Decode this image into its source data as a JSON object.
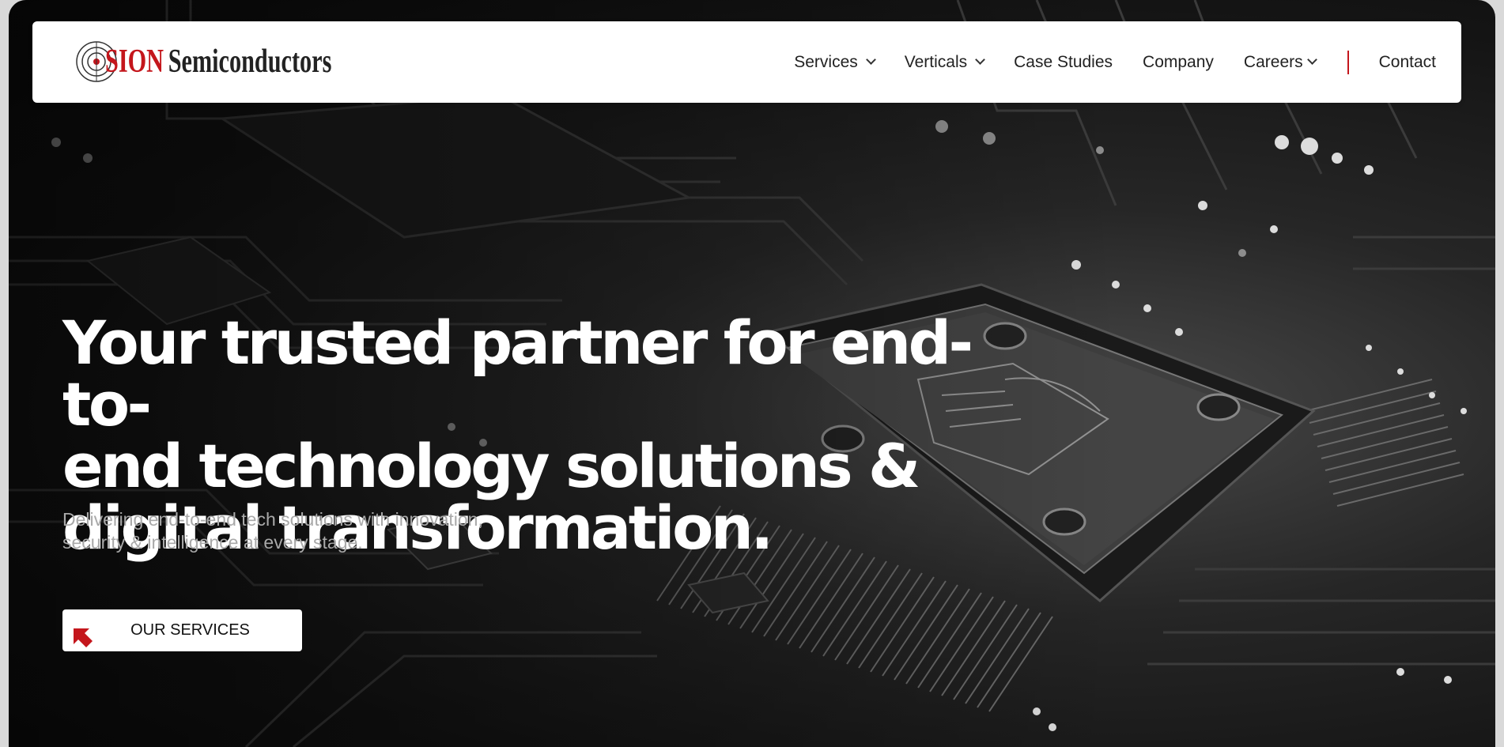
{
  "brand": {
    "name_accent": "SION",
    "name_rest": "Semiconductors",
    "accent_color": "#c4161c"
  },
  "nav": {
    "items": [
      {
        "label": "Services",
        "has_dropdown": true
      },
      {
        "label": "Verticals",
        "has_dropdown": true
      },
      {
        "label": "Case Studies",
        "has_dropdown": false
      },
      {
        "label": "Company",
        "has_dropdown": false
      },
      {
        "label": "Careers",
        "has_dropdown": true
      }
    ],
    "contact_label": "Contact"
  },
  "hero": {
    "headline_lines": [
      "Your trusted partner for end-to-",
      "end technology solutions &",
      "digital transformation."
    ],
    "subtext_lines": [
      "Delivering end-to-end tech solutions with innovation,",
      "security & intelligence at every stage."
    ],
    "cta_label": "OUR SERVICES",
    "cta_icon": "arrow-up-left-icon"
  }
}
